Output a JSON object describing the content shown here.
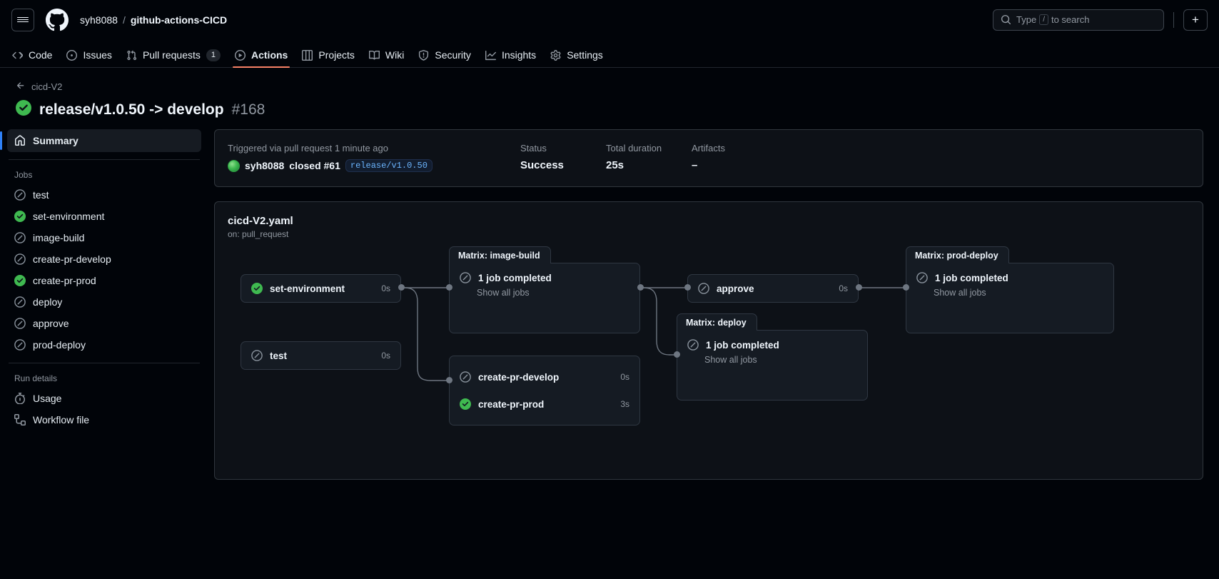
{
  "header": {
    "owner": "syh8088",
    "separator": "/",
    "repo": "github-actions-CICD",
    "search_placeholder_pre": "Type",
    "search_slash": "/",
    "search_placeholder_post": "to search",
    "plus_label": "+"
  },
  "repo_nav": [
    {
      "label": "Code",
      "icon": "code-icon",
      "selected": false,
      "count": null
    },
    {
      "label": "Issues",
      "icon": "issue-icon",
      "selected": false,
      "count": null
    },
    {
      "label": "Pull requests",
      "icon": "pr-icon",
      "selected": false,
      "count": "1"
    },
    {
      "label": "Actions",
      "icon": "play-icon",
      "selected": true,
      "count": null
    },
    {
      "label": "Projects",
      "icon": "table-icon",
      "selected": false,
      "count": null
    },
    {
      "label": "Wiki",
      "icon": "book-icon",
      "selected": false,
      "count": null
    },
    {
      "label": "Security",
      "icon": "shield-icon",
      "selected": false,
      "count": null
    },
    {
      "label": "Insights",
      "icon": "graph-icon",
      "selected": false,
      "count": null
    },
    {
      "label": "Settings",
      "icon": "gear-icon",
      "selected": false,
      "count": null
    }
  ],
  "run": {
    "back_label": "cicd-V2",
    "status_icon": "success-check-icon",
    "title": "release/v1.0.50 -> develop",
    "number": "#168"
  },
  "sidebar": {
    "summary_label": "Summary",
    "jobs_header": "Jobs",
    "jobs": [
      {
        "label": "test",
        "status": "skipped"
      },
      {
        "label": "set-environment",
        "status": "success"
      },
      {
        "label": "image-build",
        "status": "skipped"
      },
      {
        "label": "create-pr-develop",
        "status": "skipped"
      },
      {
        "label": "create-pr-prod",
        "status": "success"
      },
      {
        "label": "deploy",
        "status": "skipped"
      },
      {
        "label": "approve",
        "status": "skipped"
      },
      {
        "label": "prod-deploy",
        "status": "skipped"
      }
    ],
    "run_details_header": "Run details",
    "run_details": [
      {
        "label": "Usage",
        "icon": "stopwatch-icon"
      },
      {
        "label": "Workflow file",
        "icon": "workflow-file-icon"
      }
    ]
  },
  "summary": {
    "triggered_label": "Triggered via pull request 1 minute ago",
    "actor": "syh8088",
    "action_text": "closed #61",
    "branch_badge": "release/v1.0.50",
    "status_label": "Status",
    "status_value": "Success",
    "duration_label": "Total duration",
    "duration_value": "25s",
    "artifacts_label": "Artifacts",
    "artifacts_value": "–"
  },
  "workflow": {
    "file_name": "cicd-V2.yaml",
    "trigger": "on: pull_request",
    "show_all_jobs_label": "Show all jobs",
    "nodes": {
      "set_environment": {
        "label": "set-environment",
        "duration": "0s",
        "status": "success"
      },
      "test": {
        "label": "test",
        "duration": "0s",
        "status": "skipped"
      },
      "image_build": {
        "matrix_title": "Matrix: image-build",
        "summary": "1 job completed",
        "status": "skipped"
      },
      "create_pr_develop": {
        "label": "create-pr-develop",
        "duration": "0s",
        "status": "skipped"
      },
      "create_pr_prod": {
        "label": "create-pr-prod",
        "duration": "3s",
        "status": "success"
      },
      "approve": {
        "label": "approve",
        "duration": "0s",
        "status": "skipped"
      },
      "deploy": {
        "matrix_title": "Matrix: deploy",
        "summary": "1 job completed",
        "status": "skipped"
      },
      "prod_deploy": {
        "matrix_title": "Matrix: prod-deploy",
        "summary": "1 job completed",
        "status": "skipped"
      }
    }
  },
  "colors": {
    "success": "#3fb950",
    "skipped": "#8b949e",
    "accent": "#2f81f7",
    "selected_tab": "#f78166",
    "page_bg": "#010409",
    "card_bg": "#0d1117",
    "node_bg": "#151b23",
    "border": "#30363d"
  }
}
